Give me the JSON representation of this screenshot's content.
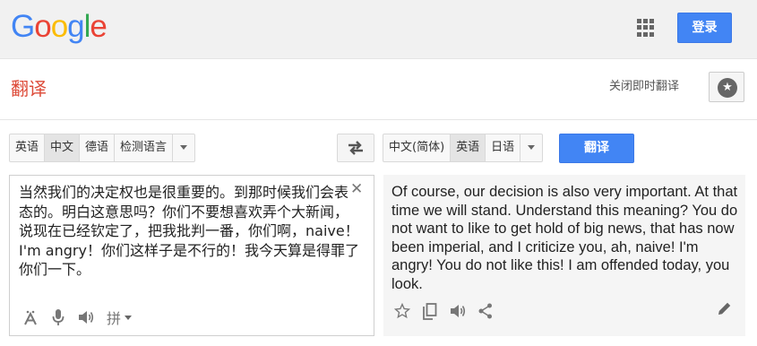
{
  "header": {
    "logo_letters": [
      {
        "char": "G",
        "color": "#4285f4"
      },
      {
        "char": "o",
        "color": "#ea4335"
      },
      {
        "char": "o",
        "color": "#fbbc05"
      },
      {
        "char": "g",
        "color": "#4285f4"
      },
      {
        "char": "l",
        "color": "#34a853"
      },
      {
        "char": "e",
        "color": "#ea4335"
      }
    ],
    "apps_icon": "apps-grid-icon",
    "login_label": "登录"
  },
  "subbar": {
    "product_title": "翻译",
    "instant_toggle_label": "关闭即时翻译",
    "star_icon": "star-icon"
  },
  "source_langs": {
    "buttons": [
      {
        "label": "英语",
        "selected": false
      },
      {
        "label": "中文",
        "selected": true
      },
      {
        "label": "德语",
        "selected": false
      },
      {
        "label": "检测语言",
        "selected": false
      }
    ]
  },
  "swap_icon": "swap-arrows-icon",
  "target_langs": {
    "buttons": [
      {
        "label": "中文(简体)",
        "selected": false
      },
      {
        "label": "英语",
        "selected": true
      },
      {
        "label": "日语",
        "selected": false
      }
    ]
  },
  "translate_label": "翻译",
  "source": {
    "text": "当然我们的决定权也是很重要的。到那时候我们会表态的。明白这意思吗？你们不要想喜欢弄个大新闻，说现在已经钦定了，把我批判一番，你们啊，naive！ I'm angry！你们这样子是不行的！我今天算是得罪了你们一下。",
    "clear_glyph": "✕",
    "tools": [
      "font-keyboard-icon",
      "microphone-icon",
      "speaker-icon",
      "pinyin-input-icon"
    ],
    "pinyin_glyph": "拼"
  },
  "target": {
    "text": "Of course, our decision is also very important. At that time we will stand. Understand this meaning? You do not want to like to get hold of big news, that has now been imperial, and I criticize you, ah, naive! I'm angry! You do not like this! I am offended today, you look.",
    "tools": [
      "star-outline-icon",
      "copy-icon",
      "speaker-icon",
      "share-icon"
    ],
    "edit_icon": "pencil-icon"
  },
  "colors": {
    "accent_blue": "#4285f4",
    "title_red": "#dd4b39",
    "header_bg": "#f1f1f1"
  }
}
